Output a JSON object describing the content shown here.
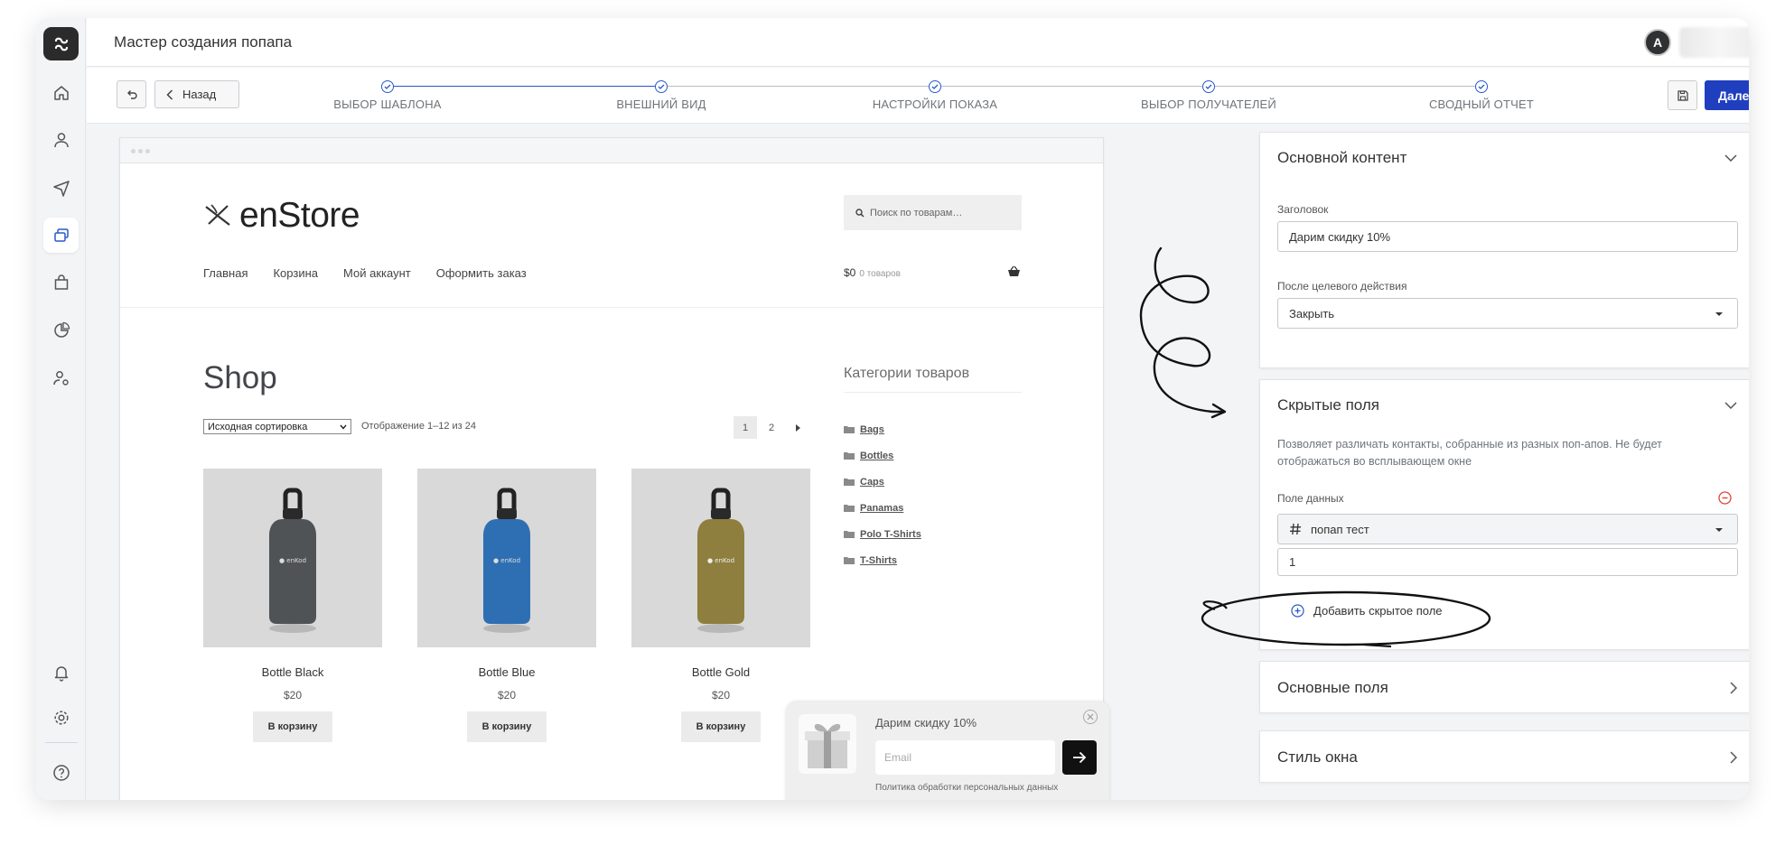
{
  "header": {
    "title": "Мастер создания попапа",
    "avatar_initial": "A"
  },
  "wizard": {
    "back_label": "Назад",
    "next_label": "Далее",
    "steps": [
      {
        "label": "ВЫБОР ШАБЛОНА"
      },
      {
        "label": "ВНЕШНИЙ ВИД"
      },
      {
        "label": "НАСТРОЙКИ ПОКАЗА"
      },
      {
        "label": "ВЫБОР ПОЛУЧАТЕЛЕЙ"
      },
      {
        "label": "СВОДНЫЙ ОТЧЕТ"
      }
    ]
  },
  "store": {
    "brand": "enStore",
    "search_placeholder": "Поиск по товарам…",
    "nav": [
      "Главная",
      "Корзина",
      "Мой аккаунт",
      "Оформить заказ"
    ],
    "cart_total": "$0",
    "cart_count": "0 товаров",
    "shop_title": "Shop",
    "sort_value": "Исходная сортировка",
    "showing": "Отображение 1–12 из 24",
    "pages": [
      "1",
      "2"
    ],
    "categories_title": "Категории товаров",
    "categories": [
      "Bags",
      "Bottles",
      "Caps",
      "Panamas",
      "Polo T-Shirts",
      "T-Shirts"
    ],
    "add_to_cart": "В корзину",
    "bottle_logo": "● enKod",
    "products": [
      {
        "name": "Bottle Black",
        "price": "$20",
        "color": "#505356"
      },
      {
        "name": "Bottle Blue",
        "price": "$20",
        "color": "#2e6fb3"
      },
      {
        "name": "Bottle Gold",
        "price": "$20",
        "color": "#8f7f3e"
      }
    ]
  },
  "popup": {
    "title": "Дарим скидку 10%",
    "email_placeholder": "Email",
    "policy": "Политика обработки персональных данных"
  },
  "panel": {
    "main_content": {
      "title": "Основной контент",
      "heading_label": "Заголовок",
      "heading_value": "Дарим скидку 10%",
      "after_action_label": "После целевого действия",
      "after_action_value": "Закрыть"
    },
    "hidden_fields": {
      "title": "Скрытые поля",
      "description": "Позволяет различать контакты, собранные из разных поп-апов. Не будет отображаться во всплывающем окне",
      "data_field_label": "Поле данных",
      "data_field_value": "попап тест",
      "value": "1",
      "add_label": "Добавить скрытое поле"
    },
    "basic_fields": {
      "title": "Основные поля"
    },
    "window_style": {
      "title": "Стиль окна"
    }
  },
  "colors": {
    "primary": "#1f3fbf",
    "accent_red": "#e0443a",
    "step_blue": "#2a59c9"
  }
}
